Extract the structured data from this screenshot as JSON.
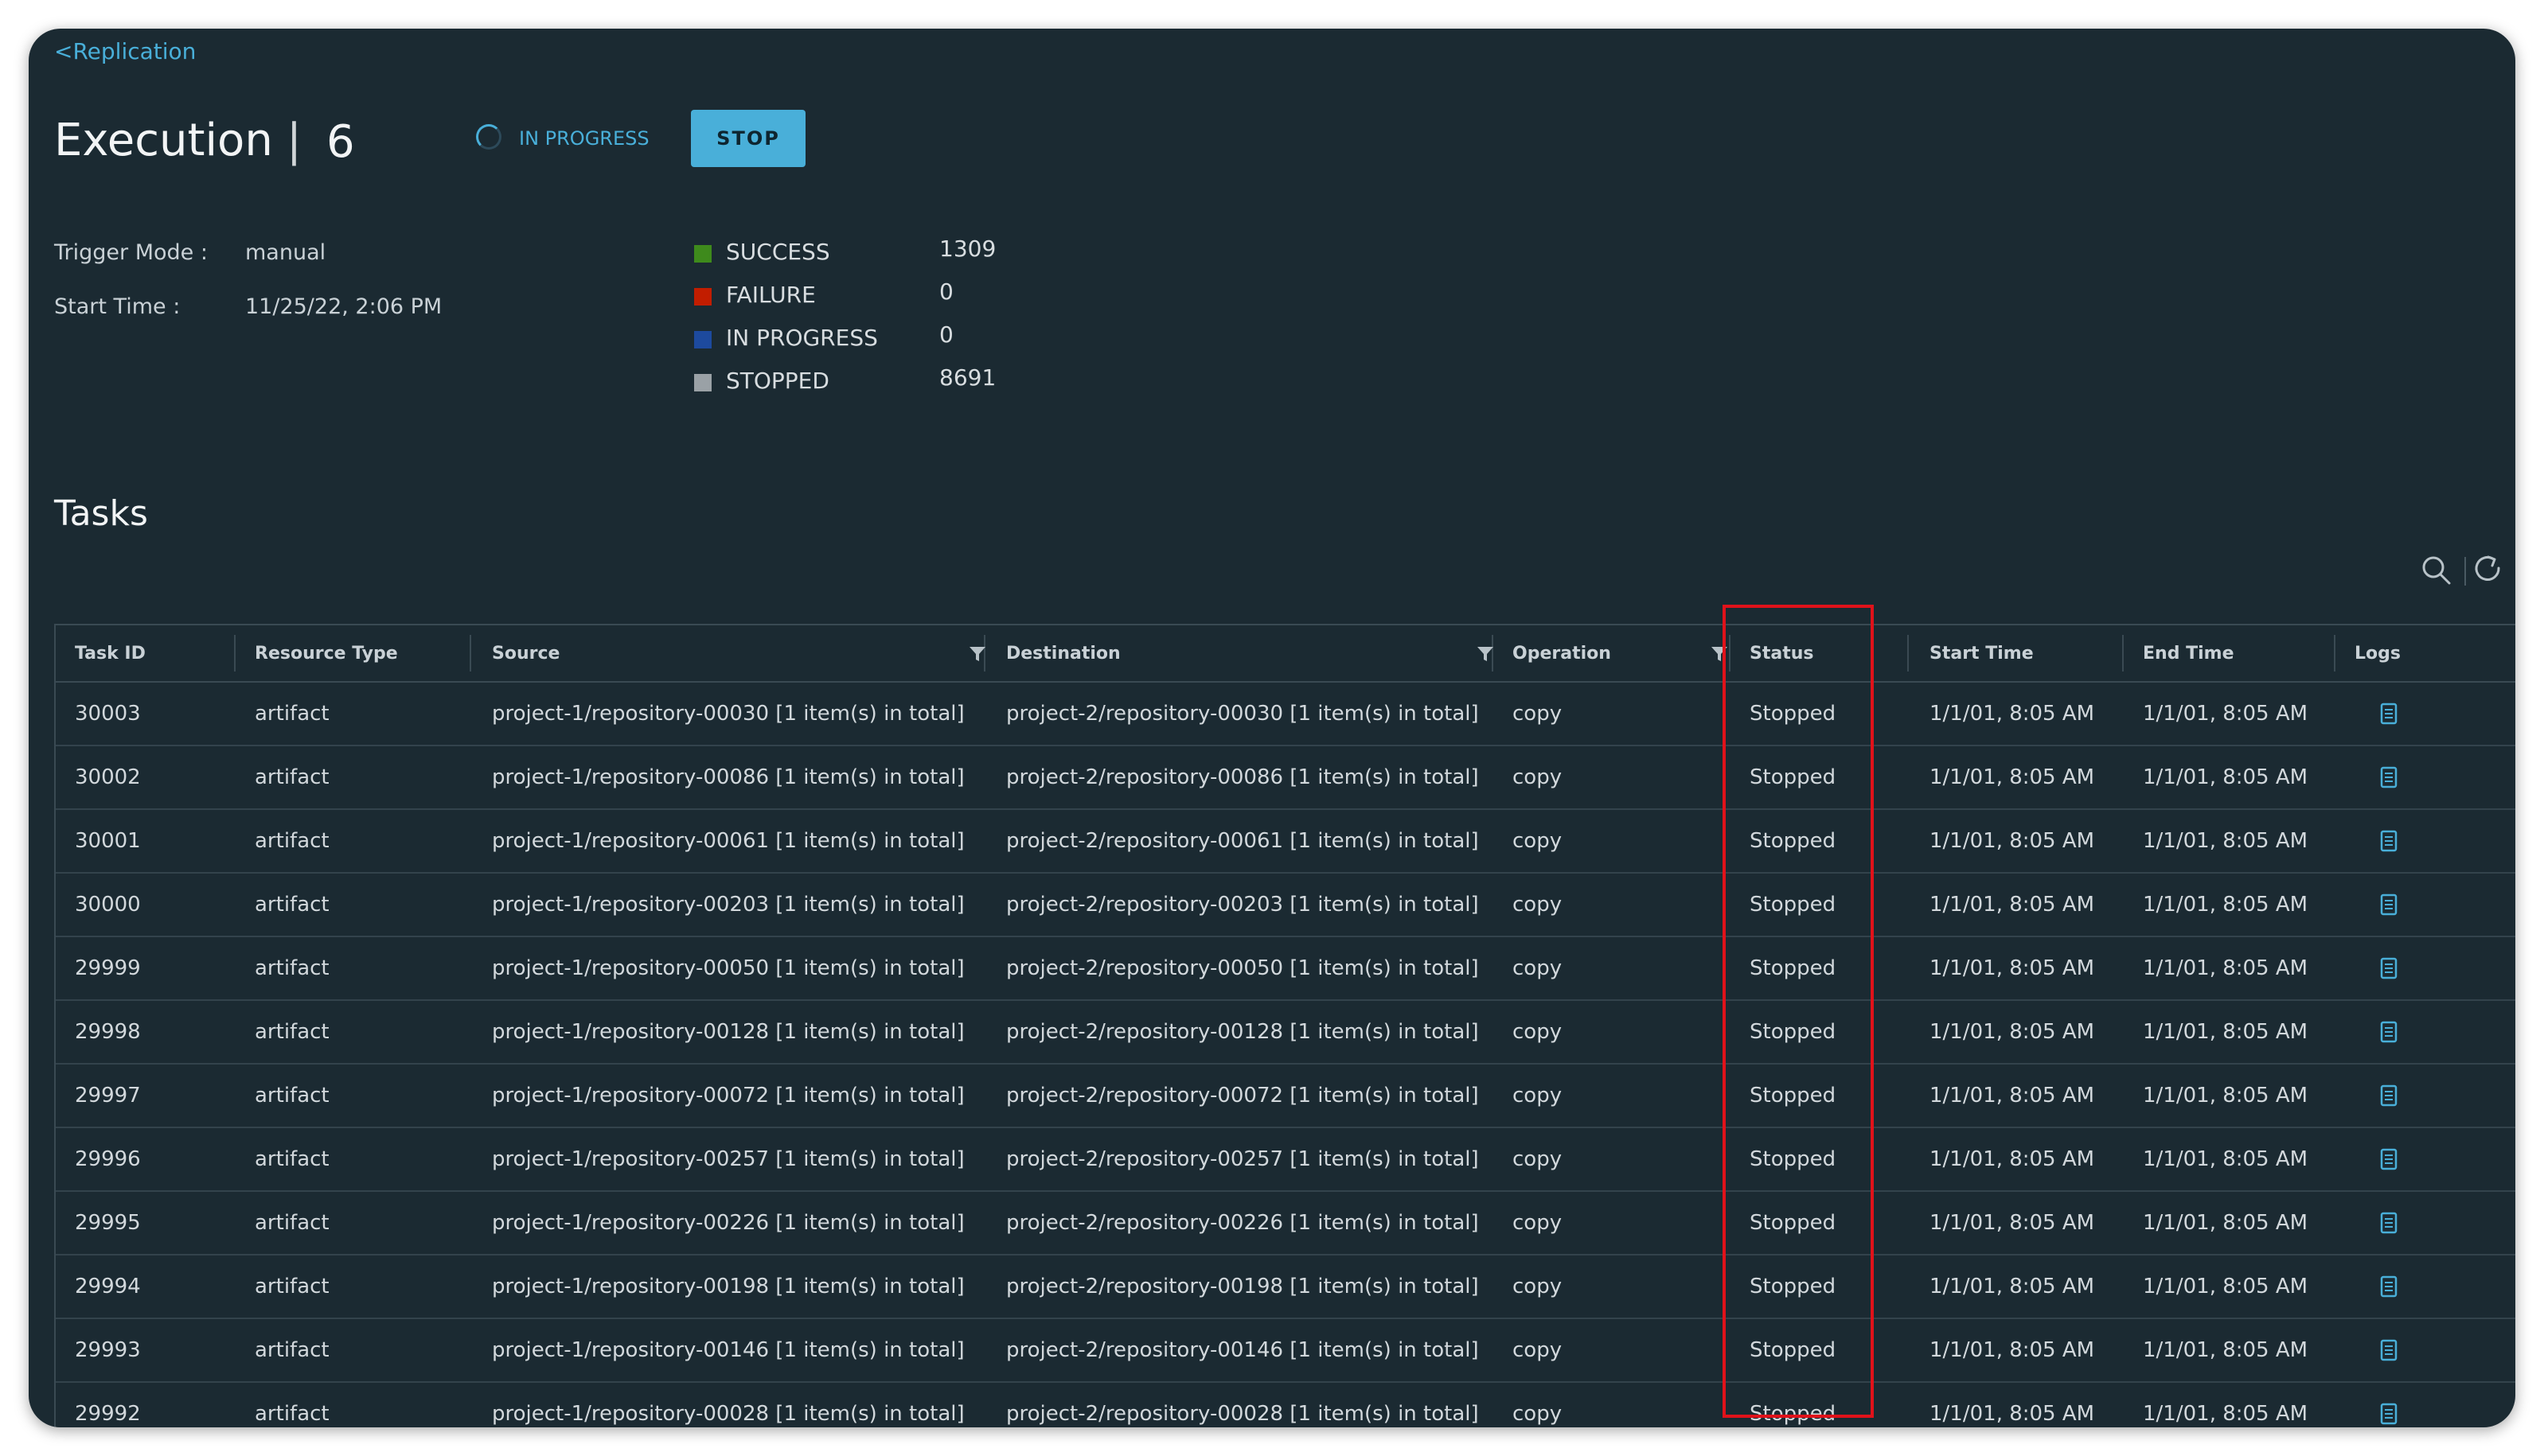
{
  "nav": {
    "back_label": "<Replication"
  },
  "header": {
    "title": "Execution",
    "separator": "|",
    "execution_id": "6",
    "status_text": "IN PROGRESS",
    "stop_label": "STOP"
  },
  "meta": {
    "trigger_mode_label": "Trigger Mode :",
    "trigger_mode_value": "manual",
    "start_time_label": "Start Time :",
    "start_time_value": "11/25/22, 2:06 PM"
  },
  "summary": [
    {
      "label": "SUCCESS",
      "value": "1309",
      "color": "#3e8a1c"
    },
    {
      "label": "FAILURE",
      "value": "0",
      "color": "#c21d00"
    },
    {
      "label": "IN PROGRESS",
      "value": "0",
      "color": "#1d4a9e"
    },
    {
      "label": "STOPPED",
      "value": "8691",
      "color": "#9aa1a6"
    }
  ],
  "tasks": {
    "title": "Tasks",
    "columns": [
      "Task ID",
      "Resource Type",
      "Source",
      "Destination",
      "Operation",
      "Status",
      "Start Time",
      "End Time",
      "Logs"
    ],
    "rows": [
      {
        "id": "30003",
        "type": "artifact",
        "source": "project-1/repository-00030 [1 item(s) in total]",
        "dest": "project-2/repository-00030 [1 item(s) in total]",
        "op": "copy",
        "status": "Stopped",
        "start": "1/1/01, 8:05 AM",
        "end": "1/1/01, 8:05 AM"
      },
      {
        "id": "30002",
        "type": "artifact",
        "source": "project-1/repository-00086 [1 item(s) in total]",
        "dest": "project-2/repository-00086 [1 item(s) in total]",
        "op": "copy",
        "status": "Stopped",
        "start": "1/1/01, 8:05 AM",
        "end": "1/1/01, 8:05 AM"
      },
      {
        "id": "30001",
        "type": "artifact",
        "source": "project-1/repository-00061 [1 item(s) in total]",
        "dest": "project-2/repository-00061 [1 item(s) in total]",
        "op": "copy",
        "status": "Stopped",
        "start": "1/1/01, 8:05 AM",
        "end": "1/1/01, 8:05 AM"
      },
      {
        "id": "30000",
        "type": "artifact",
        "source": "project-1/repository-00203 [1 item(s) in total]",
        "dest": "project-2/repository-00203 [1 item(s) in total]",
        "op": "copy",
        "status": "Stopped",
        "start": "1/1/01, 8:05 AM",
        "end": "1/1/01, 8:05 AM"
      },
      {
        "id": "29999",
        "type": "artifact",
        "source": "project-1/repository-00050 [1 item(s) in total]",
        "dest": "project-2/repository-00050 [1 item(s) in total]",
        "op": "copy",
        "status": "Stopped",
        "start": "1/1/01, 8:05 AM",
        "end": "1/1/01, 8:05 AM"
      },
      {
        "id": "29998",
        "type": "artifact",
        "source": "project-1/repository-00128 [1 item(s) in total]",
        "dest": "project-2/repository-00128 [1 item(s) in total]",
        "op": "copy",
        "status": "Stopped",
        "start": "1/1/01, 8:05 AM",
        "end": "1/1/01, 8:05 AM"
      },
      {
        "id": "29997",
        "type": "artifact",
        "source": "project-1/repository-00072 [1 item(s) in total]",
        "dest": "project-2/repository-00072 [1 item(s) in total]",
        "op": "copy",
        "status": "Stopped",
        "start": "1/1/01, 8:05 AM",
        "end": "1/1/01, 8:05 AM"
      },
      {
        "id": "29996",
        "type": "artifact",
        "source": "project-1/repository-00257 [1 item(s) in total]",
        "dest": "project-2/repository-00257 [1 item(s) in total]",
        "op": "copy",
        "status": "Stopped",
        "start": "1/1/01, 8:05 AM",
        "end": "1/1/01, 8:05 AM"
      },
      {
        "id": "29995",
        "type": "artifact",
        "source": "project-1/repository-00226 [1 item(s) in total]",
        "dest": "project-2/repository-00226 [1 item(s) in total]",
        "op": "copy",
        "status": "Stopped",
        "start": "1/1/01, 8:05 AM",
        "end": "1/1/01, 8:05 AM"
      },
      {
        "id": "29994",
        "type": "artifact",
        "source": "project-1/repository-00198 [1 item(s) in total]",
        "dest": "project-2/repository-00198 [1 item(s) in total]",
        "op": "copy",
        "status": "Stopped",
        "start": "1/1/01, 8:05 AM",
        "end": "1/1/01, 8:05 AM"
      },
      {
        "id": "29993",
        "type": "artifact",
        "source": "project-1/repository-00146 [1 item(s) in total]",
        "dest": "project-2/repository-00146 [1 item(s) in total]",
        "op": "copy",
        "status": "Stopped",
        "start": "1/1/01, 8:05 AM",
        "end": "1/1/01, 8:05 AM"
      },
      {
        "id": "29992",
        "type": "artifact",
        "source": "project-1/repository-00028 [1 item(s) in total]",
        "dest": "project-2/repository-00028 [1 item(s) in total]",
        "op": "copy",
        "status": "Stopped",
        "start": "1/1/01, 8:05 AM",
        "end": "1/1/01, 8:05 AM"
      }
    ]
  },
  "icons": {
    "search": "search-icon",
    "refresh": "refresh-icon",
    "filter": "filter-icon",
    "log": "log-file-icon",
    "spinner": "spinner-icon"
  },
  "colors": {
    "accent": "#49afd9",
    "background": "#1b2a32",
    "highlight": "#e0121a"
  }
}
